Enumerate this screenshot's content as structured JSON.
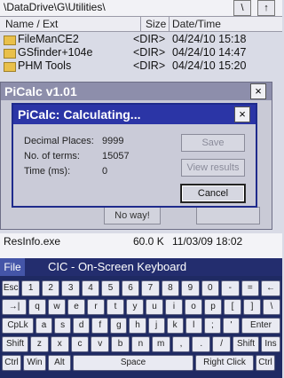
{
  "path": {
    "text": "\\DataDrive\\G\\Utilities\\",
    "btn1": "\\",
    "btn2": "↑"
  },
  "header": {
    "name": "Name / Ext",
    "size": "Size",
    "datetime": "Date/Time"
  },
  "files": [
    {
      "name": "FileManCE2",
      "size": "<DIR>",
      "date": "04/24/10 15:18"
    },
    {
      "name": "GSfinder+104e",
      "size": "<DIR>",
      "date": "04/24/10 14:47"
    },
    {
      "name": "PHM Tools",
      "size": "<DIR>",
      "date": "04/24/10 15:20"
    }
  ],
  "picalc": {
    "title": "PiCalc v1.01",
    "close": "×",
    "no_way": "No way!"
  },
  "dialog": {
    "title": "PiCalc: Calculating...",
    "close": "×",
    "decimal_label": "Decimal Places:",
    "decimal_value": "9999",
    "terms_label": "No. of terms:",
    "terms_value": "15057",
    "time_label": "Time (ms):",
    "time_value": "0",
    "save": "Save",
    "view": "View results",
    "cancel": "Cancel"
  },
  "strip": {
    "name": "ResInfo.exe",
    "size": "60.0 K",
    "date": "11/03/09 18:02"
  },
  "keyboard": {
    "file": "File",
    "title": "CIC - On-Screen Keyboard",
    "row1": [
      "Esc",
      "1",
      "2",
      "3",
      "4",
      "5",
      "6",
      "7",
      "8",
      "9",
      "0",
      "-",
      "=",
      "←"
    ],
    "row2": [
      "→|",
      "q",
      "w",
      "e",
      "r",
      "t",
      "y",
      "u",
      "i",
      "o",
      "p",
      "[",
      "]",
      "\\"
    ],
    "row3": [
      "CpLk",
      "a",
      "s",
      "d",
      "f",
      "g",
      "h",
      "j",
      "k",
      "l",
      ";",
      "'",
      "Enter"
    ],
    "row4": [
      "Shift",
      "z",
      "x",
      "c",
      "v",
      "b",
      "n",
      "m",
      ",",
      ".",
      "/",
      "Shift",
      "Ins"
    ],
    "row5": [
      "Ctrl",
      "Win",
      "Alt",
      "Space",
      "Right Click",
      "Ctrl"
    ]
  }
}
